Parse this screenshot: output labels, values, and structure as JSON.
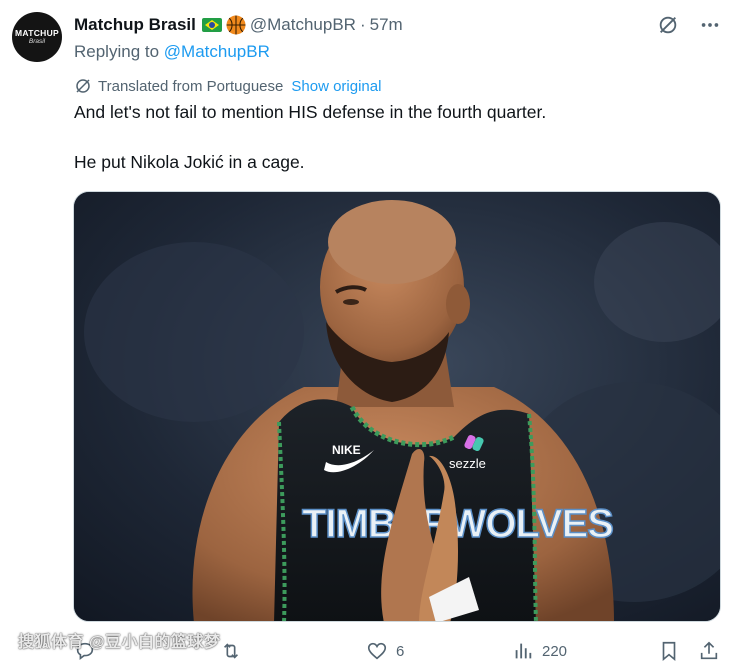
{
  "author": {
    "avatar_text": "MATCHUP",
    "avatar_subtext": "Brasil",
    "name": "Matchup Brasil",
    "handle": "@MatchupBR",
    "separator": "·",
    "time": "57m"
  },
  "reply": {
    "prefix": "Replying to ",
    "mention": "@MatchupBR"
  },
  "translation": {
    "label": "Translated from Portuguese",
    "show_original": "Show original"
  },
  "post": {
    "line1": "And let's not fail to mention HIS defense in the fourth quarter.",
    "line2": "He put Nikola Jokić in a cage."
  },
  "media": {
    "jersey_sponsor": "sezzle",
    "jersey_brand": "NIKE",
    "jersey_team": "TIMBERWOLVES"
  },
  "actions": {
    "likes": "6",
    "views": "220"
  },
  "watermark": "搜狐体育 @豆小白的篮球梦",
  "icons": {
    "grok": "grok-icon",
    "more": "more-icon",
    "translate": "translate-icon",
    "reply": "reply-icon",
    "repost": "repost-icon",
    "like": "heart-icon",
    "views": "views-icon",
    "bookmark": "bookmark-icon",
    "share": "share-icon"
  },
  "colors": {
    "accent": "#1d9bf0",
    "secondary_text": "#536471",
    "primary_text": "#0f1419"
  }
}
